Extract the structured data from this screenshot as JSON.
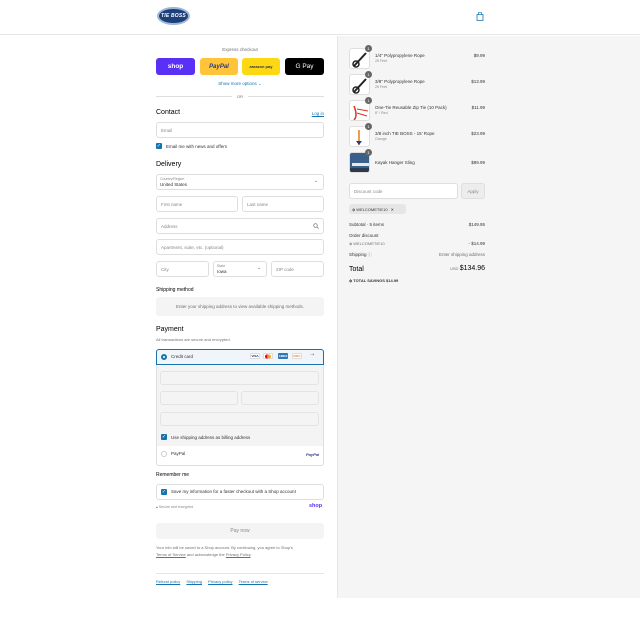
{
  "header": {
    "logo_text": "TIE BOSS",
    "cart_icon": "shopping-bag-icon"
  },
  "express": {
    "label": "Express checkout",
    "shop_label": "shop",
    "paypal_label": "PayPal",
    "amazon_label": "amazon pay",
    "gpay_label": "G Pay",
    "show_more": "Show more options",
    "or_label": "OR"
  },
  "contact": {
    "heading": "Contact",
    "login_link": "Log in",
    "email_placeholder": "Email",
    "news_label": "Email me with news and offers"
  },
  "delivery": {
    "heading": "Delivery",
    "country_label": "Country/Region",
    "country_value": "United States",
    "first_name": "First name",
    "last_name": "Last name",
    "address": "Address",
    "apartment": "Apartment, suite, etc. (optional)",
    "city": "City",
    "state_label": "State",
    "state_value": "Iowa",
    "zip": "ZIP code"
  },
  "shipping": {
    "heading": "Shipping method",
    "message": "Enter your shipping address to view available shipping methods."
  },
  "payment": {
    "heading": "Payment",
    "subtitle": "All transactions are secure and encrypted.",
    "credit_card_label": "Credit card",
    "card_brands": [
      "VISA",
      "MC",
      "AMEX",
      "DISC"
    ],
    "billing_label": "Use shipping address as billing address",
    "paypal_label": "PayPal",
    "paypal_logo": "PayPal"
  },
  "remember": {
    "heading": "Remember me",
    "save_label": "Save my information for a faster checkout with a Shop account",
    "secure_label": "Secure and encrypted",
    "shop_logo": "shop"
  },
  "pay_now": "Pay now",
  "fine_print": {
    "line1": "Your info will be saved to a Shop account. By continuing, you agree to Shop's",
    "terms": "Terms of Service",
    "and": " and acknowledge the ",
    "privacy": "Privacy Policy",
    "end": "."
  },
  "footer": {
    "refund": "Refund policy",
    "shipping": "Shipping",
    "privacy": "Privacy policy",
    "terms": "Terms of service"
  },
  "order": {
    "items": [
      {
        "qty": "1",
        "name": "1/4\" Polypropylene Rope",
        "variant": "25 Feet",
        "price": "$9.99"
      },
      {
        "qty": "1",
        "name": "3/8\" Polypropylene Rope",
        "variant": "25 Feet",
        "price": "$13.99"
      },
      {
        "qty": "1",
        "name": "One-Tie Reusable Zip Tie (10 Pack)",
        "variant": "8\" / Red",
        "price": "$11.99"
      },
      {
        "qty": "1",
        "name": "3/8 inch TIE BOSS - 15' Rope",
        "variant": "Orange",
        "price": "$23.99"
      },
      {
        "qty": "1",
        "name": "Kayak Hanger Sling",
        "variant": "",
        "price": "$89.99"
      }
    ],
    "discount_placeholder": "Discount code",
    "apply_label": "Apply",
    "code_chip": "WELCOMETIE10",
    "subtotal_label": "Subtotal · 5 items",
    "subtotal_value": "$149.95",
    "order_discount_label": "Order discount",
    "discount_code": "WELCOMETIE10",
    "discount_value": "- $14.99",
    "shipping_label": "Shipping",
    "shipping_value": "Enter shipping address",
    "total_label": "Total",
    "currency": "USD",
    "total_value": "$134.96",
    "savings_label": "TOTAL SAVINGS",
    "savings_value": "$14.99"
  }
}
